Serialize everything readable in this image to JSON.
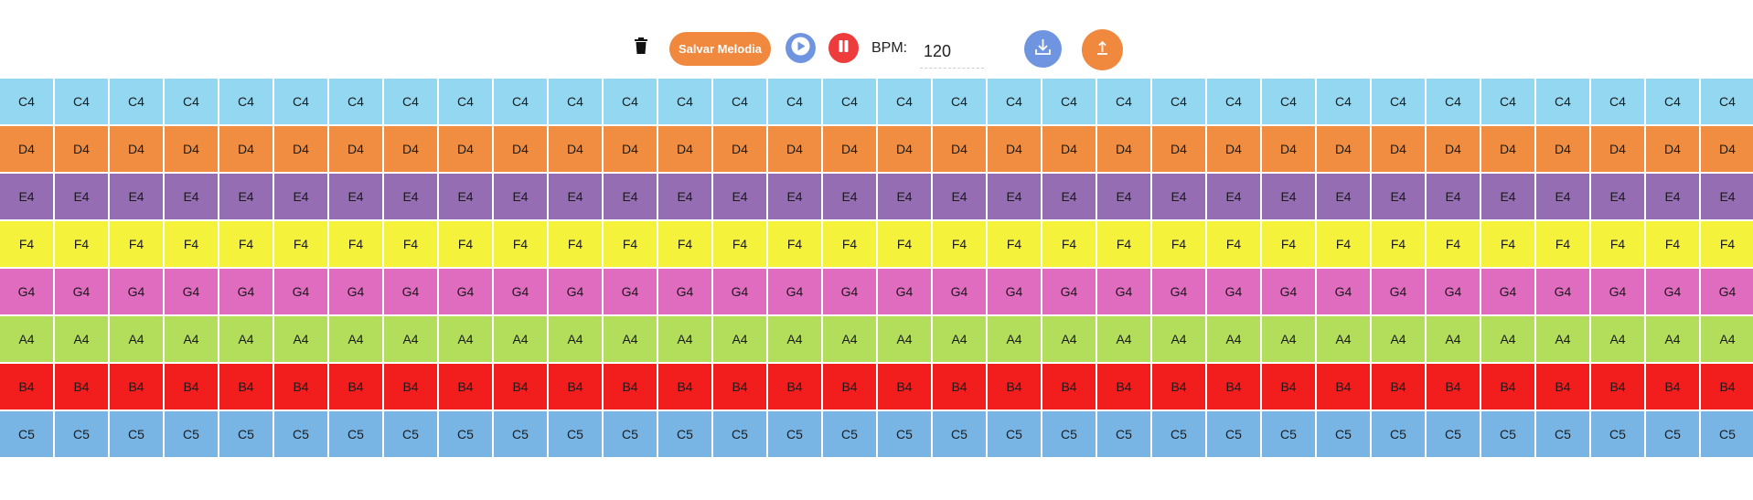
{
  "toolbar": {
    "trash_icon": "trash-icon",
    "save_label": "Salvar Melodia",
    "play_icon": "play-icon",
    "pause_icon": "pause-icon",
    "bpm_label": "BPM:",
    "bpm_value": "120",
    "download_icon": "download-icon",
    "upload_icon": "upload-icon",
    "colors": {
      "save": "#f0883e",
      "play": "#6f95e0",
      "pause": "#ee3b3b",
      "download": "#6f95e0",
      "upload": "#f0883e"
    }
  },
  "grid": {
    "columns": 32,
    "rows": [
      {
        "note": "C4",
        "color": "#93d7f0"
      },
      {
        "note": "D4",
        "color": "#f08d40"
      },
      {
        "note": "E4",
        "color": "#946db3"
      },
      {
        "note": "F4",
        "color": "#f5f23c"
      },
      {
        "note": "G4",
        "color": "#e06cc0"
      },
      {
        "note": "A4",
        "color": "#b2de5c"
      },
      {
        "note": "B4",
        "color": "#f21d1d"
      },
      {
        "note": "C5",
        "color": "#78b4e4"
      }
    ]
  }
}
